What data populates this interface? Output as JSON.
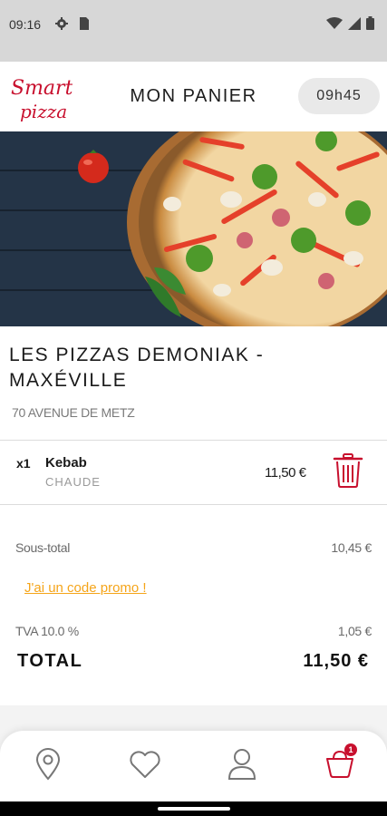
{
  "status_bar": {
    "time": "09:16",
    "icons": [
      "gear-icon",
      "sim-card-icon",
      "wifi-icon",
      "signal-icon",
      "battery-icon"
    ]
  },
  "header": {
    "logo_line1": "Smart",
    "logo_line2": "pizza",
    "title": "MON PANIER",
    "pickup_time": "09h45"
  },
  "restaurant": {
    "name": "LES PIZZAS DEMONIAK - MAXÉVILLE",
    "address": "70 AVENUE DE METZ"
  },
  "cart": {
    "items": [
      {
        "quantity": "x1",
        "name": "Kebab",
        "option": "CHAUDE",
        "price": "11,50 €"
      }
    ]
  },
  "summary": {
    "subtotal_label": "Sous-total",
    "subtotal_value": "10,45 €",
    "promo_link": "J'ai un code promo !",
    "tax_label": "TVA 10.0 %",
    "tax_value": "1,05 €",
    "total_label": "TOTAL",
    "total_value": "11,50 €"
  },
  "bottom_nav": {
    "items": [
      "location-pin-icon",
      "heart-icon",
      "user-icon",
      "cart-icon"
    ],
    "cart_badge": "1"
  },
  "colors": {
    "brand_red": "#c8102e",
    "promo_orange": "#f5a51a",
    "status_bar": "#d7d7d7"
  }
}
